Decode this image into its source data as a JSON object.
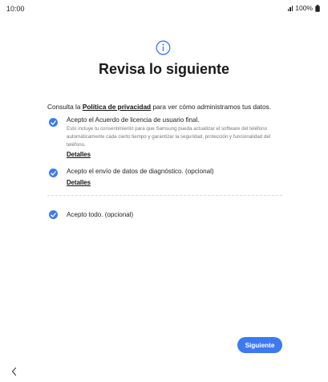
{
  "status_bar": {
    "time": "10:00",
    "battery": "100%",
    "icons": [
      "signal-icon",
      "battery-icon"
    ]
  },
  "header": {
    "icon": "info-icon",
    "title": "Revisa lo siguiente"
  },
  "intro": {
    "prefix": "Consulta la ",
    "link": "Política de privacidad",
    "suffix": " para ver cómo administramos tus datos."
  },
  "items": [
    {
      "checked": true,
      "title": "Acepto el Acuerdo de licencia de usuario final.",
      "description": "Esto incluye tu consentimiento para que Samsung pueda actualizar el software del teléfono automáticamente cada cierto tiempo y garantizar la seguridad, protección y funcionalidad del teléfono.",
      "details_label": "Detalles"
    },
    {
      "checked": true,
      "title": "Acepto el envío de datos de diagnóstico. (opcional)",
      "details_label": "Detalles"
    }
  ],
  "accept_all": {
    "checked": true,
    "label": "Acepto todo. (opcional)"
  },
  "footer": {
    "next_label": "Siguiente",
    "back_icon": "chevron-left-icon"
  },
  "colors": {
    "accent": "#3d7af0",
    "text": "#1a1a1a",
    "muted": "#777777"
  }
}
